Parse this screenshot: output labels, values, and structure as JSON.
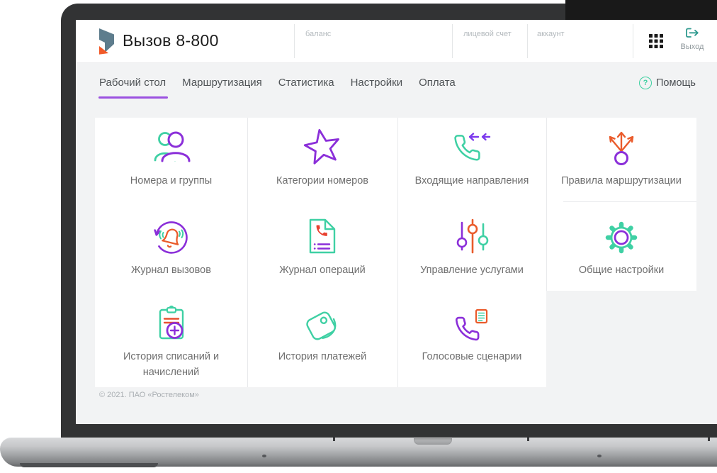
{
  "app": {
    "title": "Вызов 8-800"
  },
  "header": {
    "balance_label": "баланс",
    "personal_account_label": "лицевой счет",
    "account_label": "аккаунт",
    "logout_label": "Выход"
  },
  "nav": {
    "tabs": [
      {
        "label": "Рабочий стол",
        "active": true
      },
      {
        "label": "Маршрутизация",
        "active": false
      },
      {
        "label": "Статистика",
        "active": false
      },
      {
        "label": "Настройки",
        "active": false
      },
      {
        "label": "Оплата",
        "active": false
      }
    ],
    "help_icon": "?",
    "help_label": "Помощь"
  },
  "dashboard": {
    "tiles": [
      {
        "label": "Номера и группы",
        "icon": "users-icon"
      },
      {
        "label": "Категории номеров",
        "icon": "star-icon"
      },
      {
        "label": "Входящие направления",
        "icon": "incoming-call-icon"
      },
      {
        "label": "Правила маршрутизации",
        "icon": "route-split-icon"
      },
      {
        "label": "Журнал вызовов",
        "icon": "call-history-icon"
      },
      {
        "label": "Журнал операций",
        "icon": "operations-log-icon"
      },
      {
        "label": "Управление услугами",
        "icon": "sliders-icon"
      },
      {
        "label": "Общие настройки",
        "icon": "gear-icon"
      },
      {
        "label": "История списаний и начислений",
        "icon": "clipboard-plus-icon"
      },
      {
        "label": "История платежей",
        "icon": "wallet-icon"
      },
      {
        "label": "Голосовые сценарии",
        "icon": "voice-script-icon"
      }
    ]
  },
  "footer": {
    "copyright": "© 2021. ПАО «Ростелеком»"
  },
  "colors": {
    "purple": "#8b2fd9",
    "green": "#3fd0a4",
    "orange": "#ea5b2b",
    "tab_underline": "#9b51e0"
  }
}
